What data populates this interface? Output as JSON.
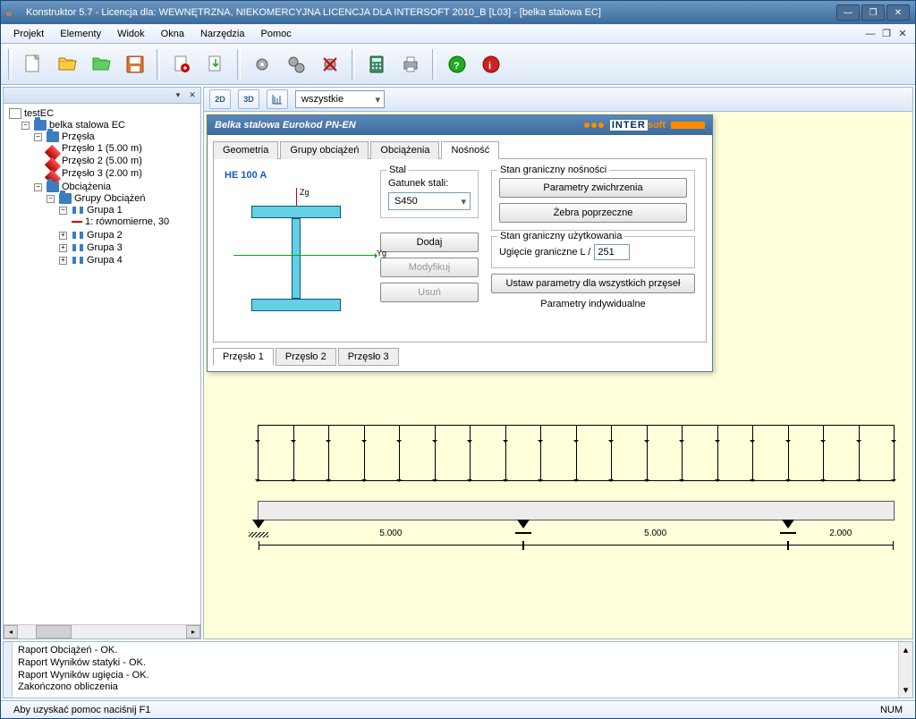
{
  "window": {
    "title": "Konstruktor 5.7 - Licencja dla: WEWNĘTRZNA, NIEKOMERCYJNA LICENCJA DLA INTERSOFT 2010_B [L03] - [belka stalowa EC]"
  },
  "menu": {
    "items": [
      "Projekt",
      "Elementy",
      "Widok",
      "Okna",
      "Narzędzia",
      "Pomoc"
    ]
  },
  "right_toolbar": {
    "btn2d": "2D",
    "btn3d": "3D",
    "filter": "wszystkie"
  },
  "tree": {
    "root": "testEC",
    "module": "belka stalowa EC",
    "spans_folder": "Przęsła",
    "spans": [
      "Przęsło 1 (5.00 m)",
      "Przęsło 2 (5.00 m)",
      "Przęsło 3 (2.00 m)"
    ],
    "loads_folder": "Obciążenia",
    "groups_folder": "Grupy Obciążeń",
    "group1": "Grupa 1",
    "group1_item": "1: równomierne, 30",
    "group2": "Grupa 2",
    "group3": "Grupa 3",
    "group4": "Grupa 4"
  },
  "dialog": {
    "title": "Belka stalowa Eurokod PN-EN",
    "brand1": "INTER",
    "brand2": "soft",
    "tabs": [
      "Geometria",
      "Grupy obciążeń",
      "Obciążenia",
      "Nośność"
    ],
    "active_tab": 3,
    "profile": "HE 100 A",
    "axis_y": "Yg",
    "axis_z": "Zg",
    "steel_legend": "Stal",
    "steel_grade_label": "Gatunek stali:",
    "steel_grade": "S450",
    "btn_add": "Dodaj",
    "btn_mod": "Modyfikuj",
    "btn_del": "Usuń",
    "uls_legend": "Stan graniczny nośności",
    "btn_buckling": "Parametry zwichrzenia",
    "btn_ribs": "Żebra poprzeczne",
    "sls_legend": "Stan graniczny użytkowania",
    "deflection_label": "Ugięcie graniczne   L /",
    "deflection_value": "251",
    "btn_all_spans": "Ustaw parametry dla wszystkich przęseł",
    "individual": "Parametry indywidualne",
    "sub_tabs": [
      "Przęsło 1",
      "Przęsło 2",
      "Przęsło 3"
    ]
  },
  "beam": {
    "span1": "5.000",
    "span2": "5.000",
    "span3": "2.000"
  },
  "log": {
    "l1": "Raport Obciążeń - OK.",
    "l2": "Raport Wyników statyki - OK.",
    "l3": "Raport Wyników ugięcia - OK.",
    "l4": "Zakończono obliczenia"
  },
  "statusbar": {
    "hint": "Aby uzyskać pomoc naciśnij F1",
    "num": "NUM"
  }
}
